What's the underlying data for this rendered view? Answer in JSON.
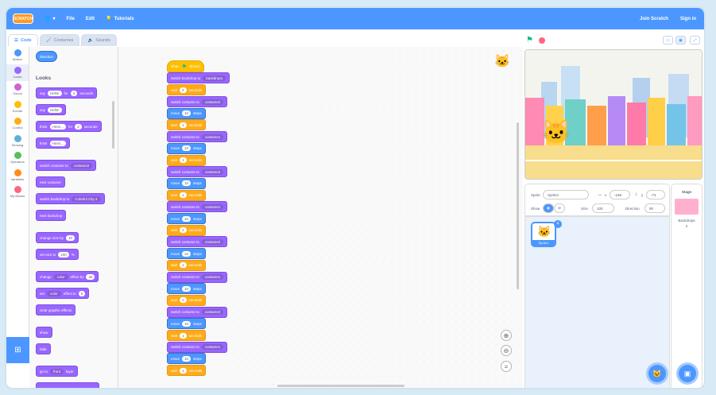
{
  "menubar": {
    "logo": "SCRATCH",
    "file": "File",
    "edit": "Edit",
    "tutorials": "Tutorials",
    "join": "Join Scratch",
    "signin": "Sign in"
  },
  "tabs": {
    "code": "Code",
    "costumes": "Costumes",
    "sounds": "Sounds"
  },
  "categories": [
    {
      "label": "Motion",
      "color": "#4c97ff"
    },
    {
      "label": "Looks",
      "color": "#9966ff"
    },
    {
      "label": "Sound",
      "color": "#cf63cf"
    },
    {
      "label": "Events",
      "color": "#ffbf00"
    },
    {
      "label": "Control",
      "color": "#ffab19"
    },
    {
      "label": "Sensing",
      "color": "#5cb1d6"
    },
    {
      "label": "Operators",
      "color": "#59c059"
    },
    {
      "label": "Variables",
      "color": "#ff8c1a"
    },
    {
      "label": "My Blocks",
      "color": "#ff6680"
    }
  ],
  "palette": {
    "direction": "direction",
    "heading": "Looks",
    "say_for": {
      "a": "say",
      "b": "Hello!",
      "c": "for",
      "d": "2",
      "e": "seconds"
    },
    "say": {
      "a": "say",
      "b": "Hello!"
    },
    "think_for": {
      "a": "think",
      "b": "Hmm...",
      "c": "for",
      "d": "2",
      "e": "seconds"
    },
    "think": {
      "a": "think",
      "b": "Hmm..."
    },
    "switch_costume": {
      "a": "switch costume to",
      "b": "costume2"
    },
    "next_costume": "next costume",
    "switch_backdrop": {
      "a": "switch backdrop to",
      "b": "Colorful City 2"
    },
    "next_backdrop": "next backdrop",
    "change_size": {
      "a": "change size by",
      "b": "10"
    },
    "set_size": {
      "a": "set size to",
      "b": "100",
      "c": "%"
    },
    "change_effect": {
      "a": "change",
      "b": "color",
      "c": "effect by",
      "d": "25"
    },
    "set_effect": {
      "a": "set",
      "b": "color",
      "c": "effect to",
      "d": "0"
    },
    "clear_effects": "clear graphic effects",
    "show": "show",
    "hide": "hide",
    "go_to_layer": {
      "a": "go to",
      "b": "front",
      "c": "layer"
    }
  },
  "script": {
    "hat": {
      "a": "when",
      "b": "clicked"
    },
    "backdrop": {
      "a": "switch backdrop to",
      "b": "backdrop1"
    },
    "wait2": {
      "a": "wait",
      "b": "2",
      "c": "seconds"
    },
    "costume_label": "switch costume to",
    "move_a": "move",
    "move_b": "10",
    "move_c": "steps",
    "wait_a": "wait",
    "wait_b": "1",
    "wait_c": "seconds",
    "costumes": [
      "costume2",
      "costume1",
      "costume2",
      "costume1",
      "costume2",
      "costume1",
      "costume2",
      "costume1"
    ]
  },
  "sprite_info": {
    "sprite_label": "Sprite",
    "sprite_name": "Sprite1",
    "x_label": "x",
    "x_value": "-158",
    "y_label": "y",
    "y_value": "-74",
    "show_label": "Show",
    "size_label": "Size",
    "size_value": "100",
    "direction_label": "Direction",
    "direction_value": "90"
  },
  "sprite_list": {
    "sprite_name": "Sprite1"
  },
  "stage_pane": {
    "title": "Stage",
    "backdrops_label": "Backdrops",
    "backdrops_count": "2"
  },
  "colors": {
    "accent": "#4c97ff",
    "looks": "#9966ff",
    "motion": "#4c97ff",
    "control": "#ffab19",
    "events": "#ffbf00"
  }
}
